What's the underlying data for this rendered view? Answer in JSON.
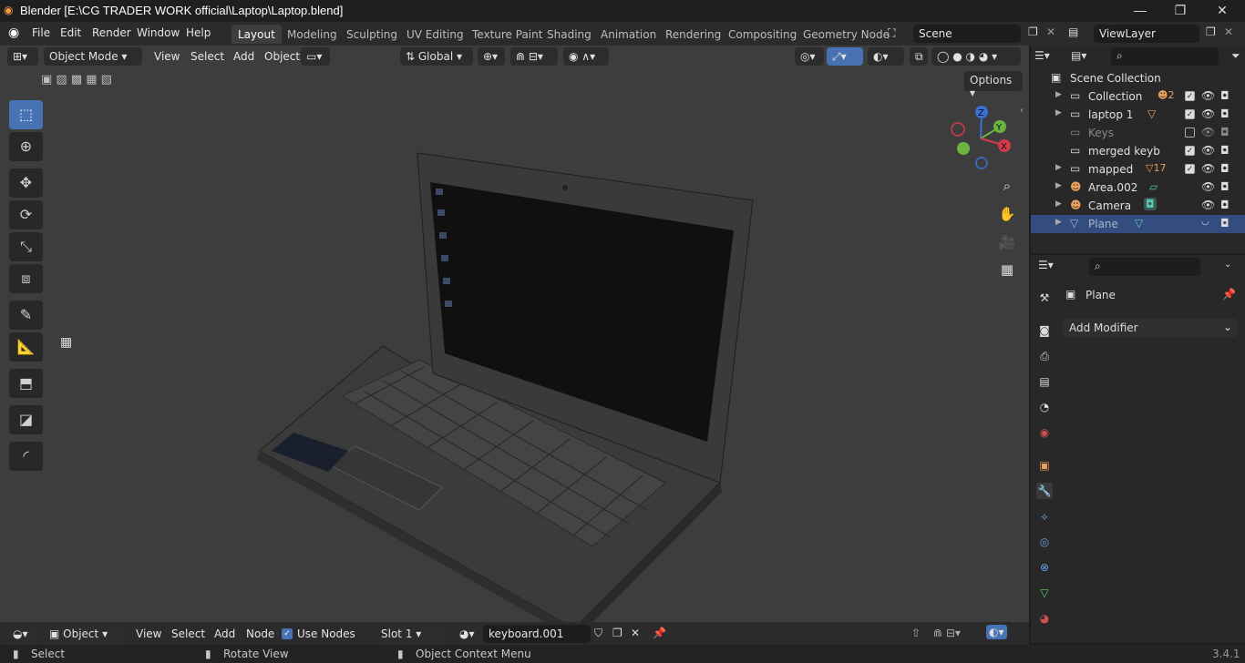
{
  "window": {
    "title": "Blender [E:\\CG TRADER WORK official\\Laptop\\Laptop.blend]",
    "minimize": "—",
    "maximize": "❐",
    "close": "✕"
  },
  "menubar": {
    "items": [
      "File",
      "Edit",
      "Render",
      "Window",
      "Help"
    ],
    "workspaces": [
      "Layout",
      "Modeling",
      "Sculpting",
      "UV Editing",
      "Texture Paint",
      "Shading",
      "Animation",
      "Rendering",
      "Compositing",
      "Geometry Node"
    ],
    "active_workspace": "Layout",
    "scene": "Scene",
    "view_layer": "ViewLayer"
  },
  "viewport": {
    "mode": "Object Mode",
    "menus": [
      "View",
      "Select",
      "Add",
      "Object"
    ],
    "orientation": "Global",
    "options": "Options",
    "gizmo_axes": {
      "z": "Z",
      "y": "Y",
      "x": "X"
    }
  },
  "outliner": {
    "root": "Scene Collection",
    "items": [
      {
        "name": "Collection",
        "badge": "2",
        "checked": true,
        "has_eye": true
      },
      {
        "name": "laptop 1",
        "badge": "",
        "checked": true,
        "has_eye": true
      },
      {
        "name": "Keys",
        "badge": "",
        "checked": false,
        "has_eye": true
      },
      {
        "name": "merged keyb",
        "badge": "",
        "checked": true,
        "has_eye": true
      },
      {
        "name": "mapped",
        "badge": "17",
        "checked": true,
        "has_eye": true
      },
      {
        "name": "Area.002",
        "badge": "",
        "checked": false,
        "has_eye": true
      },
      {
        "name": "Camera",
        "badge": "",
        "checked": false,
        "has_eye": true
      },
      {
        "name": "Plane",
        "badge": "",
        "checked": false,
        "has_eye": false,
        "selected": true
      }
    ]
  },
  "properties": {
    "object_name": "Plane",
    "add_modifier": "Add Modifier"
  },
  "shader_header": {
    "editor": "Object",
    "menus": [
      "View",
      "Select",
      "Add",
      "Node"
    ],
    "use_nodes": "Use Nodes",
    "slot": "Slot 1",
    "material": "keyboard.001"
  },
  "statusbar": {
    "select": "Select",
    "rotate": "Rotate View",
    "context": "Object Context Menu",
    "version": "3.4.1"
  },
  "colors": {
    "accent": "#4772b3",
    "selected_row": "#334d80",
    "viewport_bg": "#3d3d3d"
  }
}
